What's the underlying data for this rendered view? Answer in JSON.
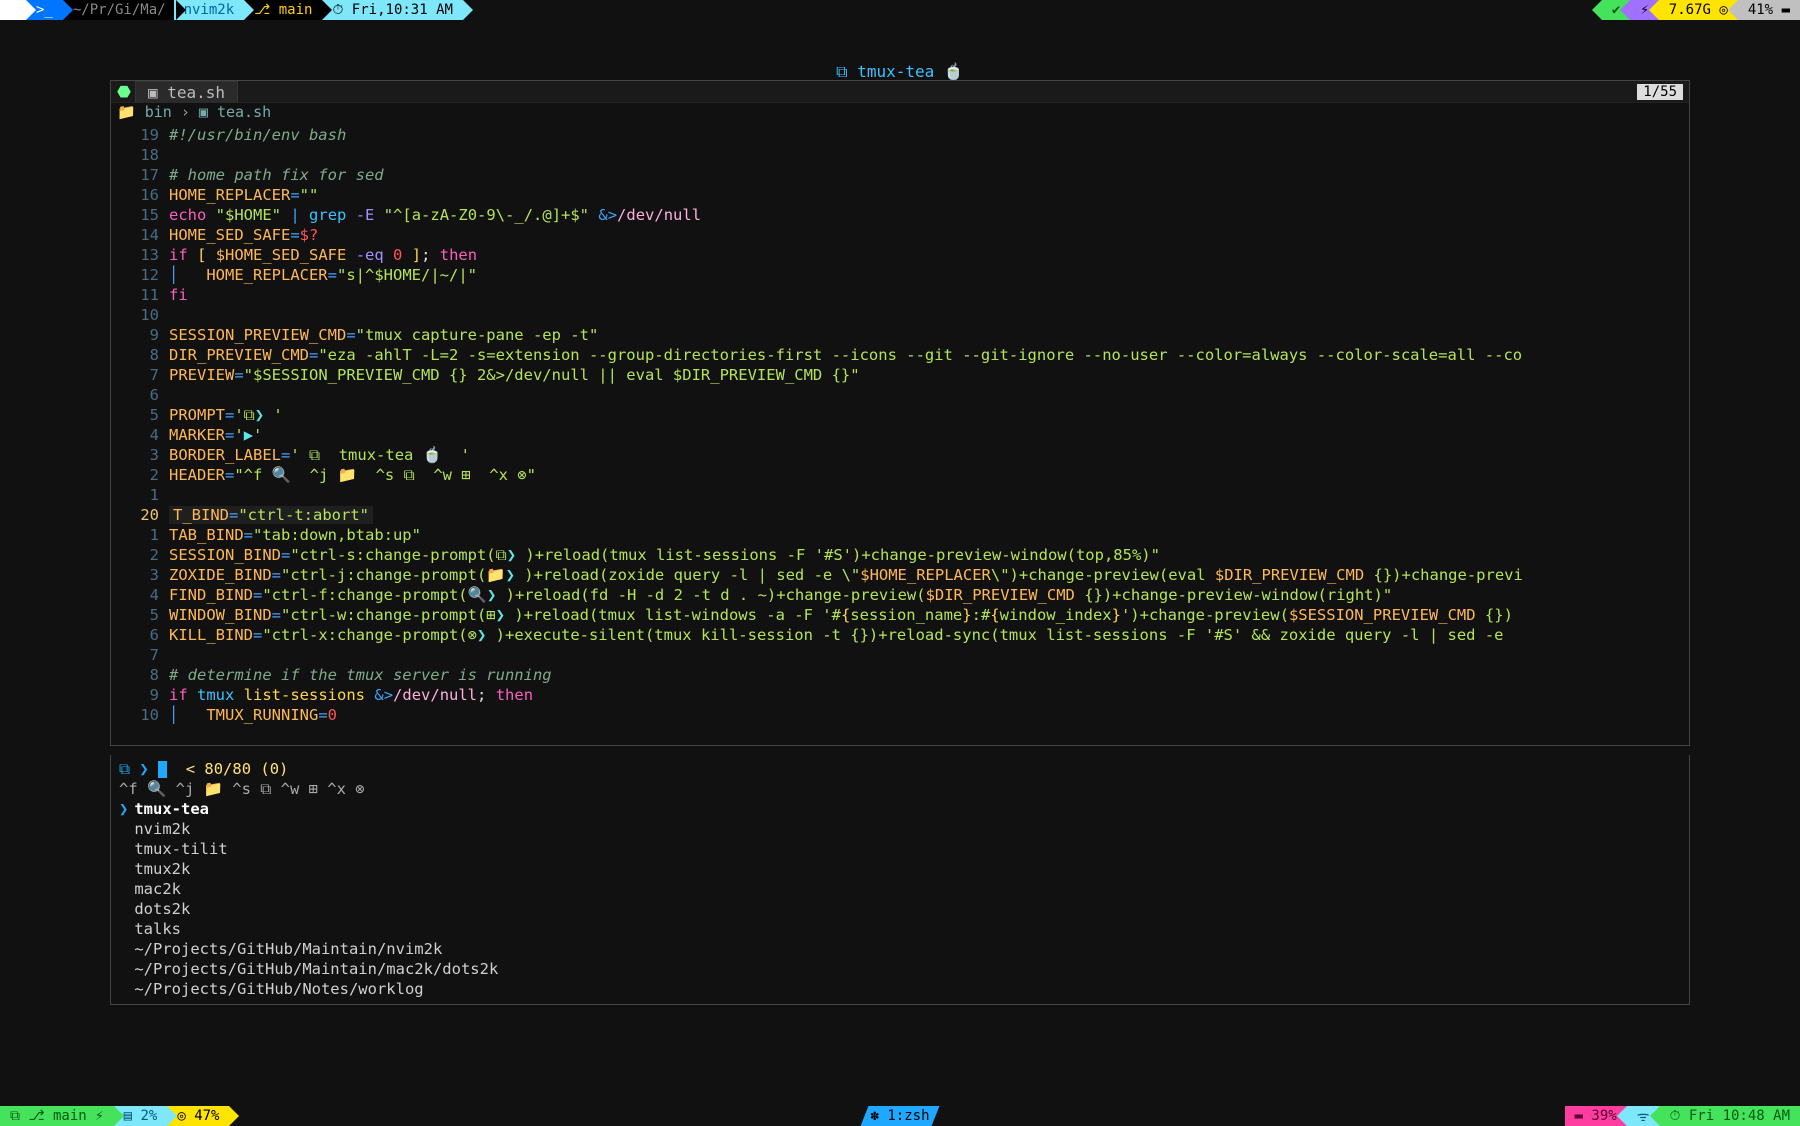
{
  "menubar": {
    "apple": "",
    "term_icon": ">_",
    "path_short": "~/Pr/Gi/Ma/",
    "path_tail": "nvim2k",
    "branch": "main",
    "git_icon": "⎇",
    "time_left": "Fri,10:31 AM",
    "right_check": "✔",
    "right_flash": "⚡",
    "right_mem": "7.67G",
    "right_mem_icon": "◎",
    "right_batt": "41%",
    "right_batt_icon": "▬"
  },
  "top_title": "⧉  tmux-tea  🍵",
  "editor": {
    "tab_label": "▣ tea.sh",
    "page_count": "1/55",
    "breadcrumb": "📁 bin  ›  ▣ tea.sh",
    "lines": [
      {
        "num": "19",
        "html": "<span class='c-cmnt'>#!/usr/bin/env bash</span>"
      },
      {
        "num": "18",
        "html": ""
      },
      {
        "num": "17",
        "html": "<span class='c-cmnt'># home path fix for sed</span>"
      },
      {
        "num": "16",
        "html": "<span class='c-var'>HOME_REPLACER</span><span class='c-op'>=</span><span class='c-str'>\"\"</span>"
      },
      {
        "num": "15",
        "html": "<span class='c-key'>echo</span> <span class='c-str'>\"$HOME\"</span> <span class='c-op'>|</span> <span class='c-func'>grep</span> <span class='c-flag'>-E</span> <span class='c-str'>\"^[a-zA-Z0-9\\-_/.@]+$\"</span> <span class='c-op'>&amp;&gt;</span><span class='c-pink'>/dev/null</span>"
      },
      {
        "num": "14",
        "html": "<span class='c-var'>HOME_SED_SAFE</span><span class='c-op'>=</span><span class='c-red'>$?</span>"
      },
      {
        "num": "13",
        "html": "<span class='c-key'>if</span> <span class='c-yel'>[</span> <span class='c-var'>$HOME_SED_SAFE</span> <span class='c-flag'>-eq</span> <span class='c-red'>0</span> <span class='c-yel'>]</span><span class='c-white'>;</span> <span class='c-key'>then</span>"
      },
      {
        "num": "12",
        "html": "<span class='c-op'>│   </span><span class='c-var'>HOME_REPLACER</span><span class='c-op'>=</span><span class='c-str'>\"s|^$HOME/|~/|\"</span>"
      },
      {
        "num": "11",
        "html": "<span class='c-key'>fi</span>"
      },
      {
        "num": "10",
        "html": ""
      },
      {
        "num": "9",
        "html": "<span class='c-var'>SESSION_PREVIEW_CMD</span><span class='c-op'>=</span><span class='c-str'>\"tmux capture-pane -ep -t\"</span>"
      },
      {
        "num": "8",
        "html": "<span class='c-var'>DIR_PREVIEW_CMD</span><span class='c-op'>=</span><span class='c-str'>\"eza -ahlT -L=2 -s=extension --group-directories-first --icons --git --git-ignore --no-user --color=always --color-scale=all --co</span>"
      },
      {
        "num": "7",
        "html": "<span class='c-var'>PREVIEW</span><span class='c-op'>=</span><span class='c-str'>\"$SESSION_PREVIEW_CMD {} 2&amp;&gt;/dev/null || eval $DIR_PREVIEW_CMD {}\"</span>"
      },
      {
        "num": "6",
        "html": ""
      },
      {
        "num": "5",
        "html": "<span class='c-var'>PROMPT</span><span class='c-op'>=</span><span class='c-str'>'⧉<span class='c-cyan'>❯</span> '</span>"
      },
      {
        "num": "4",
        "html": "<span class='c-var'>MARKER</span><span class='c-op'>=</span><span class='c-str'>'<span class='c-cyan'>▶</span>'</span>"
      },
      {
        "num": "3",
        "html": "<span class='c-var'>BORDER_LABEL</span><span class='c-op'>=</span><span class='c-str'>' ⧉  tmux-tea 🍵  '</span>"
      },
      {
        "num": "2",
        "html": "<span class='c-var'>HEADER</span><span class='c-op'>=</span><span class='c-str'>\"^f 🔍  ^j 📁  ^s ⧉  ^w ⊞  ^x ⊗\"</span>"
      },
      {
        "num": "1",
        "html": ""
      },
      {
        "num": "20",
        "html": "<span class='hl-line' style='padding:0 4px;'><span class='c-var'>T_BIND</span><span class='c-op'>=</span><span class='c-str'>\"ctrl-t:abort\"</span></span>",
        "current": true
      },
      {
        "num": "1",
        "html": "<span class='c-var'>TAB_BIND</span><span class='c-op'>=</span><span class='c-str'>\"tab:down,btab:up\"</span>"
      },
      {
        "num": "2",
        "html": "<span class='c-var'>SESSION_BIND</span><span class='c-op'>=</span><span class='c-str'>\"ctrl-s:change-prompt(⧉<span class='c-cyan'>❯</span> )+reload(tmux list-sessions -F '#S')+change-preview-window(top,85%)\"</span>"
      },
      {
        "num": "3",
        "html": "<span class='c-var'>ZOXIDE_BIND</span><span class='c-op'>=</span><span class='c-str'>\"ctrl-j:change-prompt(📁<span class='c-cyan'>❯</span> )+reload(zoxide query -l | sed -e \\\"<span class='c-var'>$HOME_REPLACER</span>\\\")+change-preview(eval <span class='c-var'>$DIR_PREVIEW_CMD</span> {})+change-previ</span>"
      },
      {
        "num": "4",
        "html": "<span class='c-var'>FIND_BIND</span><span class='c-op'>=</span><span class='c-str'>\"ctrl-f:change-prompt(🔍<span class='c-cyan'>❯</span> )+reload(fd -H -d 2 -t d . ~)+change-preview(<span class='c-var'>$DIR_PREVIEW_CMD</span> {})+change-preview-window(right)\"</span>"
      },
      {
        "num": "5",
        "html": "<span class='c-var'>WINDOW_BIND</span><span class='c-op'>=</span><span class='c-str'>\"ctrl-w:change-prompt(⊞<span class='c-cyan'>❯</span> )+reload(tmux list-windows -a -F '#<span class='c-yel'>{</span>session_name<span class='c-yel'>}</span>:#<span class='c-yel'>{</span>window_index<span class='c-yel'>}</span>')+change-preview(<span class='c-var'>$SESSION_PREVIEW_CMD</span> {})</span>"
      },
      {
        "num": "6",
        "html": "<span class='c-var'>KILL_BIND</span><span class='c-op'>=</span><span class='c-str'>\"ctrl-x:change-prompt(⊗<span class='c-cyan'>❯</span> )+execute-silent(tmux kill-session -t {})+reload-sync(tmux list-sessions -F '#S' &amp;&amp; zoxide query -l | sed -e</span>"
      },
      {
        "num": "7",
        "html": ""
      },
      {
        "num": "8",
        "html": "<span class='c-cmnt'># determine if the tmux server is running</span>"
      },
      {
        "num": "9",
        "html": "<span class='c-key'>if</span> <span class='c-func'>tmux</span> <span class='c-yel'>list-sessions</span> <span class='c-op'>&amp;&gt;</span><span class='c-pink'>/dev/null</span><span class='c-white'>;</span> <span class='c-key'>then</span>"
      },
      {
        "num": "10",
        "html": "<span class='c-op'>│   </span><span class='c-var'>TMUX_RUNNING</span><span class='c-op'>=</span><span class='c-red'>0</span>"
      }
    ]
  },
  "fzf": {
    "prompt_icons": "⧉ ❯ ",
    "count": "< 80/80 (0)",
    "header": "^f 🔍  ^j 📁  ^s ⧉  ^w ⊞  ^x ⊗",
    "items": [
      {
        "label": "tmux-tea",
        "selected": true
      },
      {
        "label": "nvim2k"
      },
      {
        "label": "tmux-tilit"
      },
      {
        "label": "tmux2k"
      },
      {
        "label": "mac2k"
      },
      {
        "label": "dots2k"
      },
      {
        "label": "talks"
      },
      {
        "label": "~/Projects/GitHub/Maintain/nvim2k"
      },
      {
        "label": "~/Projects/GitHub/Maintain/mac2k/dots2k"
      },
      {
        "label": "~/Projects/GitHub/Notes/worklog"
      }
    ]
  },
  "status": {
    "left_session_icon": "⧉",
    "left_git": "⎇ main ⚡",
    "left_cpu_icon": "▤",
    "left_cpu": "2%",
    "left_ram_icon": "◎",
    "left_ram": "47%",
    "center": "✽ 1:zsh",
    "right_batt_icon": "▬",
    "right_batt": "39%",
    "right_wifi": "ᯤ",
    "right_time": "⏱ Fri 10:48 AM"
  }
}
